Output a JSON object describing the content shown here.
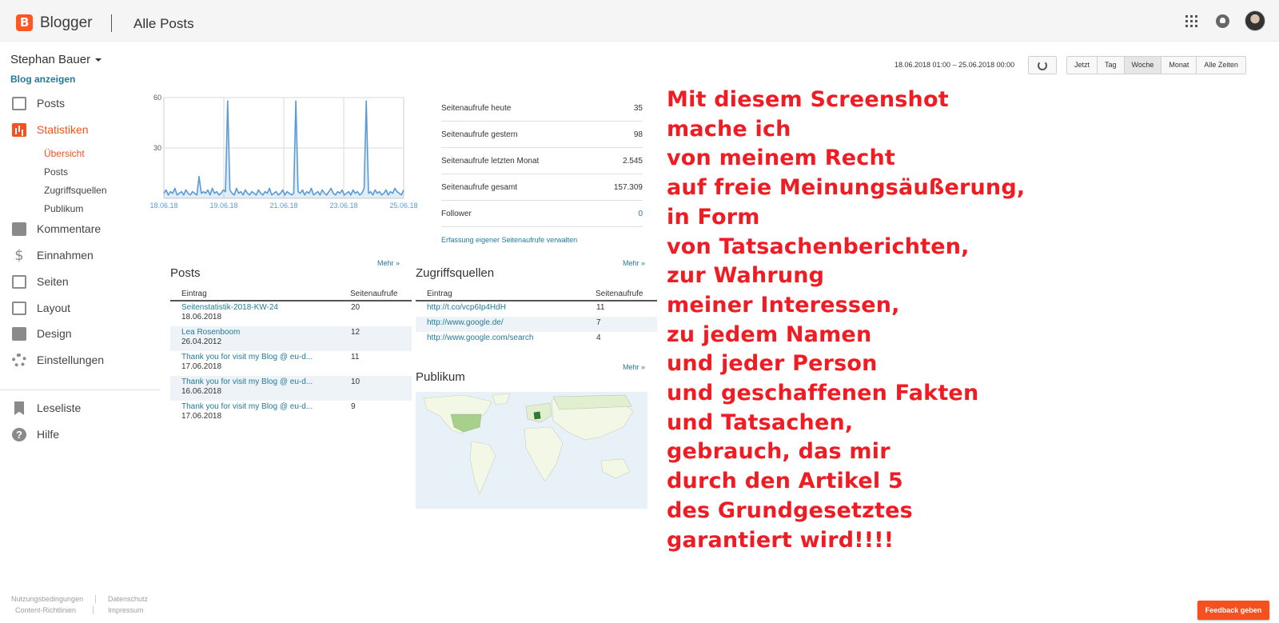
{
  "app": {
    "brand": "Blogger",
    "page_title": "Alle Posts",
    "brand_color": "#ff5722",
    "accent_color": "#f4511e",
    "link_color": "#1f7b9a"
  },
  "sidebar": {
    "user_name": "Stephan Bauer",
    "blog_link": "Blog anzeigen",
    "items": [
      {
        "label": "Posts",
        "icon": "posts-icon"
      },
      {
        "label": "Statistiken",
        "icon": "stats-icon",
        "active": true
      },
      {
        "label": "Kommentare",
        "icon": "comment-icon"
      },
      {
        "label": "Einnahmen",
        "icon": "dollar-icon"
      },
      {
        "label": "Seiten",
        "icon": "pages-icon"
      },
      {
        "label": "Layout",
        "icon": "layout-icon"
      },
      {
        "label": "Design",
        "icon": "paint-roller-icon"
      },
      {
        "label": "Einstellungen",
        "icon": "gear-icon"
      },
      {
        "label": "Leseliste",
        "icon": "bookmark-icon"
      },
      {
        "label": "Hilfe",
        "icon": "help-icon"
      }
    ],
    "stats_sub": [
      "Übersicht",
      "Posts",
      "Zugriffsquellen",
      "Publikum"
    ],
    "footer": [
      "Nutzungsbedingungen",
      "Datenschutz",
      "Content-Richtlinien",
      "Impressum"
    ]
  },
  "toolbar": {
    "date_range": "18.06.2018 01:00 – 25.06.2018 00:00",
    "ranges": [
      "Jetzt",
      "Tag",
      "Woche",
      "Monat",
      "Alle Zeiten"
    ],
    "selected_range": "Woche"
  },
  "chart_data": {
    "type": "line",
    "title": "",
    "xlabel": "",
    "ylabel": "",
    "ylim": [
      0,
      60
    ],
    "yticks": [
      "60",
      "30"
    ],
    "xticks": [
      "18.06.18",
      "19.06.18",
      "21.06.18",
      "23.06.18",
      "25.06.18"
    ],
    "series": [
      {
        "color": "#5b9bd5",
        "values": [
          3,
          5,
          2,
          4,
          3,
          6,
          2,
          3,
          4,
          2,
          5,
          3,
          2,
          4,
          3,
          2,
          13,
          3,
          4,
          3,
          5,
          2,
          6,
          3,
          4,
          2,
          3,
          5,
          4,
          58,
          5,
          3,
          2,
          6,
          3,
          4,
          2,
          5,
          3,
          2,
          4,
          3,
          2,
          5,
          3,
          2,
          4,
          3,
          6,
          2,
          3,
          4,
          2,
          3,
          5,
          2,
          4,
          3,
          2,
          3,
          58,
          4,
          3,
          5,
          2,
          4,
          3,
          6,
          2,
          3,
          4,
          2,
          5,
          3,
          2,
          4,
          6,
          3,
          2,
          4,
          3,
          5,
          2,
          3,
          4,
          2,
          5,
          3,
          4,
          2,
          3,
          6,
          58,
          3,
          4,
          2,
          5,
          3,
          4,
          2,
          3,
          5,
          2,
          4,
          3,
          6,
          4,
          3,
          2,
          5
        ]
      }
    ]
  },
  "summary": {
    "rows": [
      {
        "label": "Seitenaufrufe heute",
        "value": "35"
      },
      {
        "label": "Seitenaufrufe gestern",
        "value": "98"
      },
      {
        "label": "Seitenaufrufe letzten Monat",
        "value": "2.545"
      },
      {
        "label": "Seitenaufrufe gesamt",
        "value": "157.309"
      },
      {
        "label": "Follower",
        "value": "0"
      }
    ],
    "manage_link": "Erfassung eigener Seitenaufrufe verwalten"
  },
  "posts": {
    "title": "Posts",
    "more": "Mehr »",
    "col1": "Eintrag",
    "col2": "Seitenaufrufe",
    "rows": [
      {
        "title": "Seitenstatistik-2018-KW-24",
        "date": "18.06.2018",
        "views": "20"
      },
      {
        "title": "Lea Rosenboom",
        "date": "26.04.2012",
        "views": "12"
      },
      {
        "title": "Thank you for visit my Blog @ eu-d...",
        "date": "17.06.2018",
        "views": "11"
      },
      {
        "title": "Thank you for visit my Blog @ eu-d...",
        "date": "16.06.2018",
        "views": "10"
      },
      {
        "title": "Thank you for visit my Blog @ eu-d...",
        "date": "17.06.2018",
        "views": "9"
      }
    ]
  },
  "sources": {
    "title": "Zugriffsquellen",
    "more": "Mehr »",
    "col1": "Eintrag",
    "col2": "Seitenaufrufe",
    "rows": [
      {
        "url": "http://t.co/vcp6Ip4HdH",
        "views": "11"
      },
      {
        "url": "http://www.google.de/",
        "views": "7"
      },
      {
        "url": "http://www.google.com/search",
        "views": "4"
      }
    ]
  },
  "audience": {
    "title": "Publikum",
    "more": "Mehr »"
  },
  "overlay_lines": [
    "Mit diesem Screenshot",
    "mache ich",
    "von meinem Recht",
    "auf freie Meinungsäußerung,",
    "in Form",
    "von Tatsachenberichten,",
    "zur Wahrung",
    "meiner Interessen,",
    "zu jedem Namen",
    "und jeder Person",
    "und geschaffenen Fakten",
    "und Tatsachen,",
    "gebrauch, das mir",
    "durch den Artikel 5",
    "des Grundgesetztes",
    "garantiert wird!!!!"
  ],
  "feedback": "Feedback geben"
}
